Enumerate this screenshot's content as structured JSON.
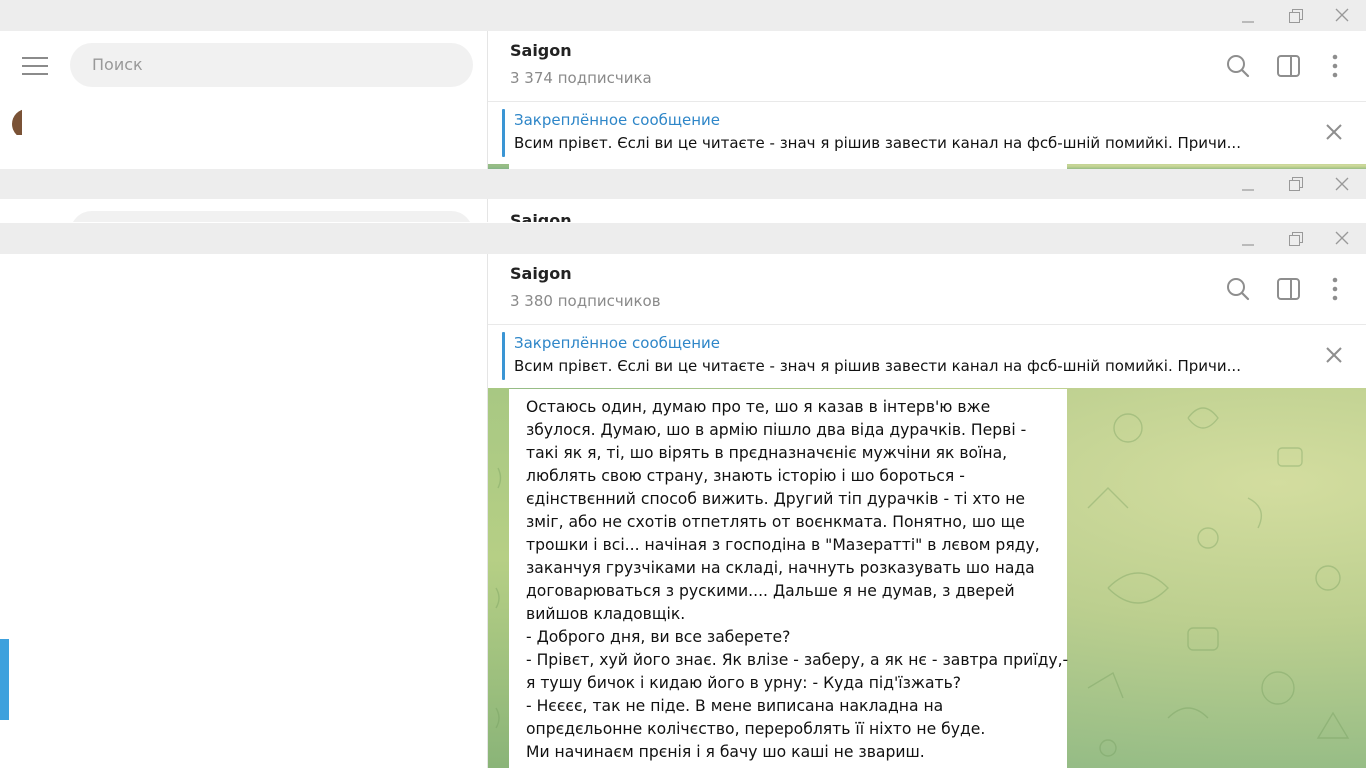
{
  "search": {
    "placeholder": "Поиск"
  },
  "window_top": {
    "channel_title": "Saigon",
    "subscribers": "3 374 подписчика",
    "pinned_title": "Закреплённое сообщение",
    "pinned_text": "Всим прівєт.   Єслі ви це читаєте - знач я рішив завести канал на фсб-шній помийкі.   Причи..."
  },
  "window_mid": {
    "channel_title": "Saigon"
  },
  "window_main": {
    "channel_title": "Saigon",
    "subscribers": "3 380 подписчиков",
    "pinned_title": "Закреплённое сообщение",
    "pinned_text": "Всим прівєт.   Єслі ви це читаєте - знач я рішив завести канал на фсб-шній помийкі.   Причи..."
  },
  "message": {
    "lines": [
      "Остаюсь один, думаю про те, шо я казав в інтерв'ю вже",
      "збулося. Думаю, шо в армію пішло два віда дурачків. Перві -",
      "такі як я, ті, шо вірять в прєдназначєніє мужчіни як воїна,",
      "люблять свою страну, знають історію і шо бороться -",
      "єдінствєнний способ вижить. Другий тіп дурачків - ті хто не",
      "зміг, або не схотів отпетлять от воєнкмата. Понятно, шо ще",
      "трошки і всі... начіная з господіна в \"Мазераттi\" в лєвом ряду,",
      "заканчуя грузчіками на складі, начнуть розказувать шо нада",
      "договарюваться з рускими.... Дальше я не думав, з дверей",
      "вийшов кладовщік.",
      "- Доброго дня, ви все заберете?",
      "- Прівєт, хуй його знає. Як влізе - заберу, а як нє - завтра приїду,-",
      "я тушу бичок і кидаю його в урну: - Куда під'їзжать?",
      "- Нєєєє, так не піде. В мене виписана накладна на",
      "опрєдєльонне колічєство, перероблять її ніхто не буде.",
      "Ми начинаєм прєнія і я бачу шо каші не звариш."
    ]
  },
  "colors": {
    "accent": "#3a95d4",
    "titlebar": "#ededed",
    "pinned_title": "#2e86c8",
    "wallpaper": "#bccf8f"
  },
  "icons": [
    "menu-icon",
    "search-icon",
    "sidebar-toggle-icon",
    "more-vertical-icon",
    "close-icon",
    "minimize-icon",
    "maximize-icon",
    "window-close-icon"
  ]
}
